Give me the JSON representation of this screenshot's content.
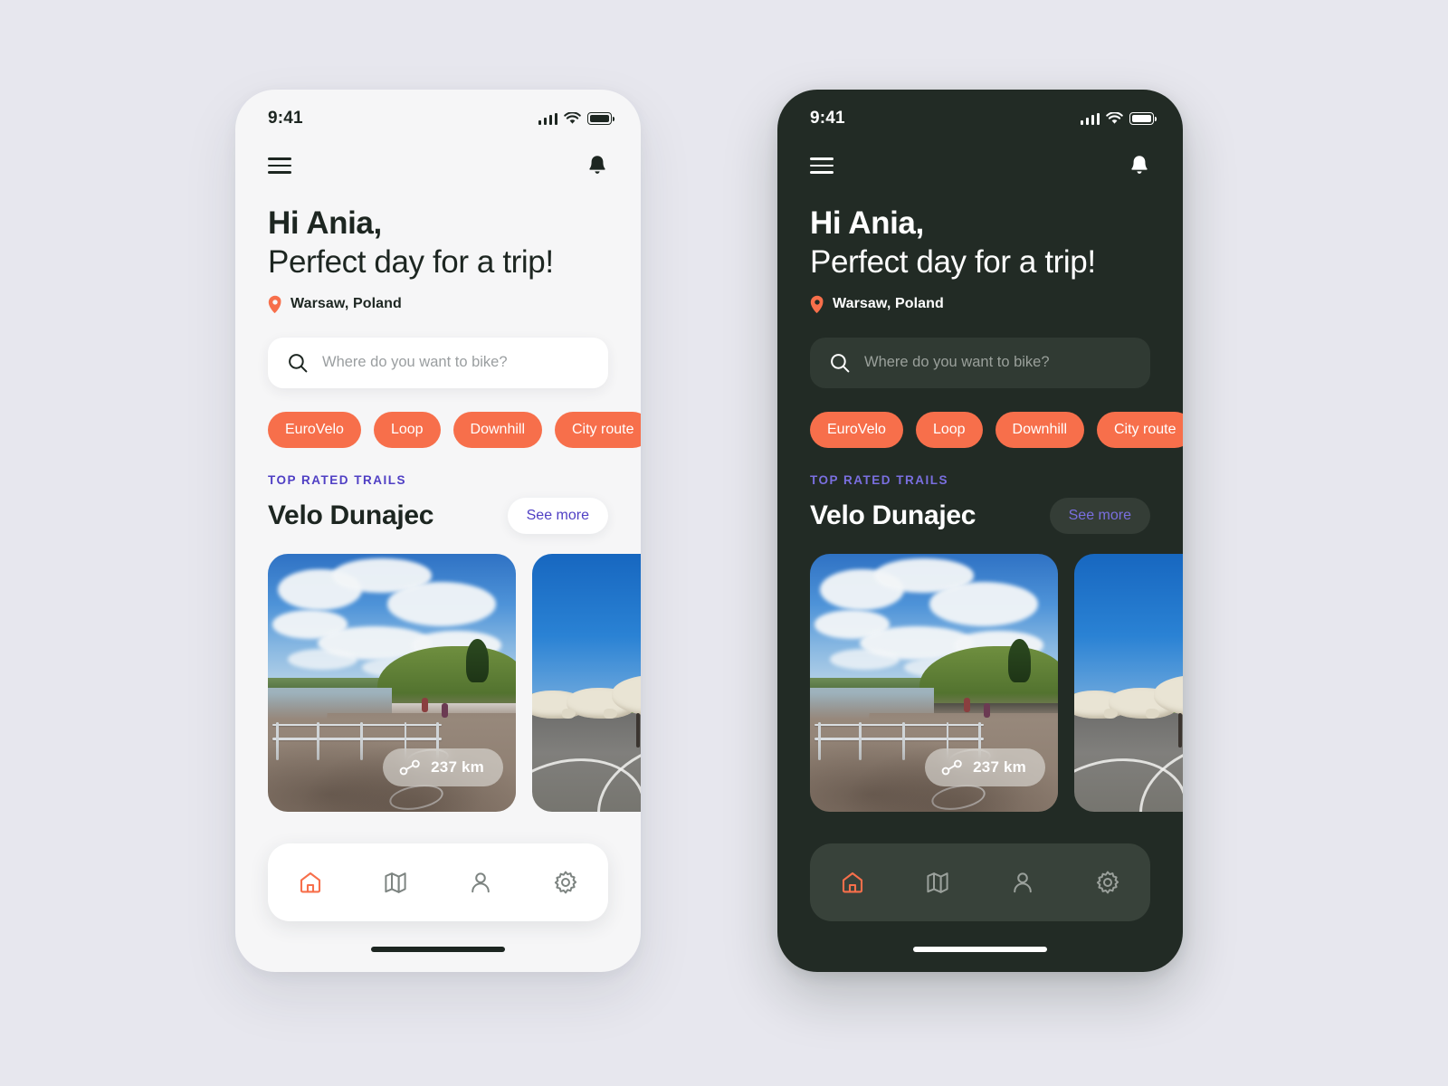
{
  "page": {
    "background": "#e7e7ee"
  },
  "theme": {
    "accent_orange": "#f76f4b",
    "accent_purple_light": "#4f3fc4",
    "accent_purple_dark": "#7a6fe0",
    "light_bg": "#f6f6f7",
    "dark_bg": "#222b25",
    "light_text": "#1d2621",
    "dark_text": "#ffffff"
  },
  "status_bar": {
    "time": "9:41",
    "icons": [
      "signal-icon",
      "wifi-icon",
      "battery-icon"
    ]
  },
  "topbar": {
    "menu_icon": "hamburger-menu-icon",
    "notification_icon": "bell-icon"
  },
  "greeting": {
    "line1": "Hi Ania,",
    "line2": "Perfect day for a trip!",
    "location": "Warsaw, Poland",
    "location_icon": "map-pin-icon"
  },
  "search": {
    "placeholder": "Where do you want to bike?",
    "value": "",
    "icon": "search-icon"
  },
  "chips": [
    {
      "label": "EuroVelo"
    },
    {
      "label": "Loop"
    },
    {
      "label": "Downhill"
    },
    {
      "label": "City route"
    }
  ],
  "section": {
    "label": "TOP RATED TRAILS",
    "title": "Velo Dunajec",
    "see_more_label": "See more"
  },
  "cards": [
    {
      "alt": "Bike path along a lake with cyclists under a cloudy blue sky",
      "distance": "237 km",
      "distance_icon": "route-icon"
    },
    {
      "alt": "Sheep crossing an asphalt road with bike lane markings",
      "distance": "",
      "distance_icon": ""
    }
  ],
  "bottom_nav": {
    "items": [
      {
        "name": "home",
        "icon": "home-icon",
        "active": true
      },
      {
        "name": "map",
        "icon": "map-icon",
        "active": false
      },
      {
        "name": "profile",
        "icon": "person-icon",
        "active": false
      },
      {
        "name": "settings",
        "icon": "gear-icon",
        "active": false
      }
    ]
  },
  "home_indicator": {
    "name": "home-indicator"
  }
}
